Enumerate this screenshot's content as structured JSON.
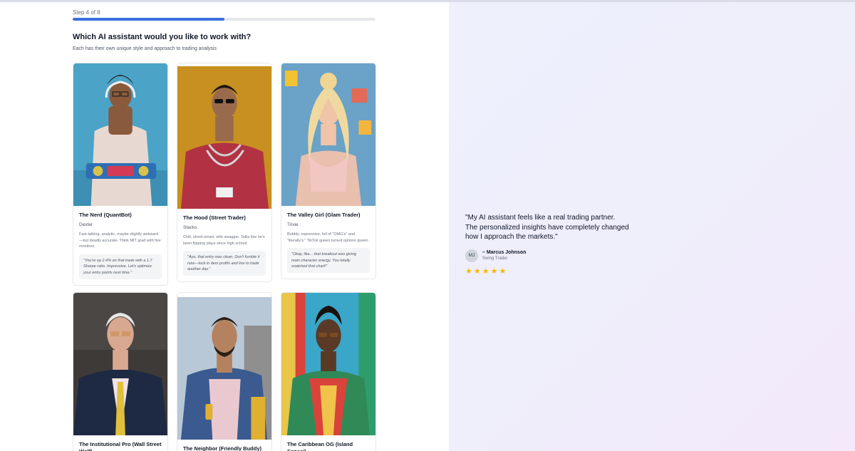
{
  "progress": {
    "label": "Step 4 of 8",
    "fraction": 0.5,
    "accent_color": "#3b6fe0"
  },
  "header": {
    "question": "Which AI assistant would you like to work with?",
    "subtitle": "Each has their own unique style and approach to trading analysis"
  },
  "assistants": [
    {
      "title": "The Nerd (QuantBot)",
      "name": "Dexter",
      "description": "Fast-talking, analytic, maybe slightly awkward—but deadly accurate. Think MIT grad with five monitors.",
      "quote": "\"You're up 2.4% on that trade with a 1.7 Sharpe ratio. Impressive. Let's optimize your entry points next time.\""
    },
    {
      "title": "The Hood (Street Trader)",
      "name": "Stacks",
      "description": "Chill, street-smart, with swagger. Talks like he's been flipping plays since high school.",
      "quote": "\"Ayo, that entry was clean. Don't fumble it now—lock in dem profits and live to trade another day.\""
    },
    {
      "title": "The Valley Girl (Glam Trader)",
      "name": "Trixie",
      "description": "Bubbly, expressive, full of \"OMG's\" and \"literally's.\" TikTok queen turned options queen.",
      "quote": "\"Okay, like... that breakout was giving main character energy. You totally snatched that chart!\""
    },
    {
      "title": "The Institutional Pro (Wall Street Wolf)",
      "name": "",
      "description": "",
      "quote": ""
    },
    {
      "title": "The Neighbor (Friendly Buddy)",
      "name": "",
      "description": "",
      "quote": ""
    },
    {
      "title": "The Caribbean OG (Island Sensei)",
      "name": "",
      "description": "",
      "quote": ""
    }
  ],
  "testimonial": {
    "quote": "\"My AI assistant feels like a real trading partner. The personalized insights have completely changed how I approach the markets.\"",
    "initials": "MJ",
    "name": "– Marcus Johnson",
    "role": "Swing Trader",
    "rating": 5,
    "star_glyph": "★",
    "star_color": "#f5b800"
  }
}
